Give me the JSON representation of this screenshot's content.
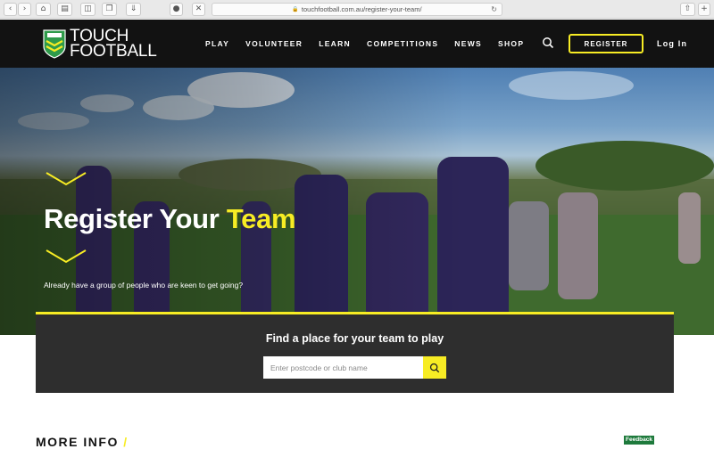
{
  "browser": {
    "url": "touchfootball.com.au/register-your-team/"
  },
  "header": {
    "logo_text_line1": "TOUCH",
    "logo_text_line2": "FOOTBALL",
    "nav": [
      {
        "label": "PLAY"
      },
      {
        "label": "VOLUNTEER"
      },
      {
        "label": "LEARN"
      },
      {
        "label": "COMPETITIONS"
      },
      {
        "label": "NEWS"
      },
      {
        "label": "SHOP"
      }
    ],
    "register_label": "REGISTER",
    "login_label": "Log In"
  },
  "hero": {
    "title_main": "Register Your ",
    "title_accent": "Team",
    "subtitle": "Already have a group of people who are keen to get going?"
  },
  "find": {
    "title": "Find a place for your team to play",
    "placeholder": "Enter postcode or club name"
  },
  "more_info": {
    "label": "MORE INFO",
    "slash": "/"
  },
  "feedback_label": "Feedback",
  "colors": {
    "accent": "#f7ec24",
    "header_bg": "#121212",
    "panel_bg": "#2e2e2e",
    "feedback_bg": "#1e7a3c"
  }
}
